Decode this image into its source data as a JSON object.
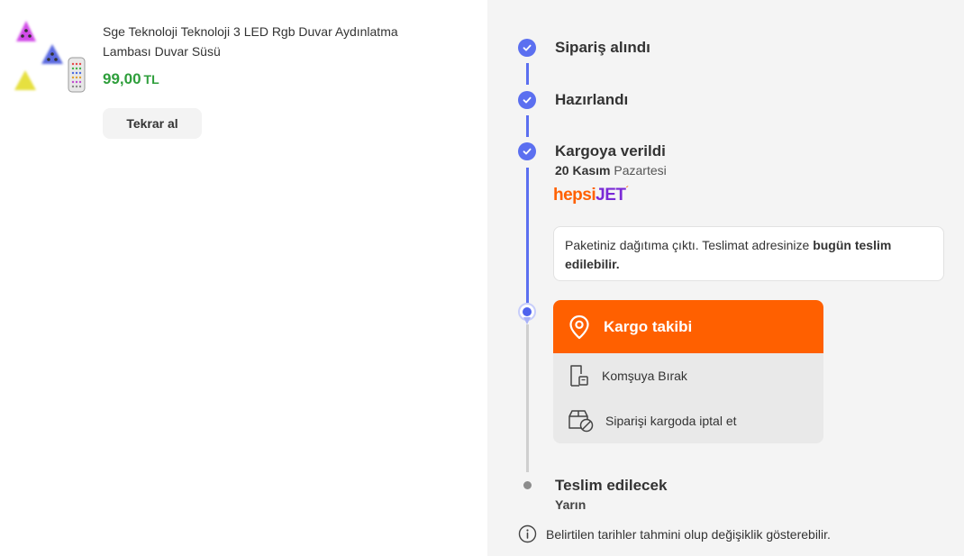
{
  "product": {
    "title": "Sge Teknoloji Teknoloji 3 LED Rgb Duvar Aydınlatma Lambası Duvar Süsü",
    "price": "99,00",
    "currency": "TL",
    "rebuy_label": "Tekrar al"
  },
  "timeline": {
    "steps": [
      {
        "label": "Sipariş alındı"
      },
      {
        "label": "Hazırlandı"
      },
      {
        "label": "Kargoya verildi"
      }
    ],
    "shipped_date_bold": "20 Kasım",
    "shipped_day": "Pazartesi",
    "carrier_part1": "hepsi",
    "carrier_part2": "JET",
    "info_text": "Paketiniz dağıtıma çıktı. Teslimat adresinize ",
    "info_text_bold": "bugün teslim edilebilir.",
    "track_label": "Kargo takibi",
    "option_neighbor": "Komşuya Bırak",
    "option_cancel": "Siparişi kargoda iptal et",
    "final_label": "Teslim edilecek",
    "final_sub": "Yarın"
  },
  "note": "Belirtilen tarihler tahmini olup değişiklik gösterebilir.",
  "colors": {
    "accent_blue": "#5b6ff0",
    "orange": "#ff6000",
    "price_green": "#2e9e3b",
    "hepsijet_purple": "#7a2ad6"
  }
}
